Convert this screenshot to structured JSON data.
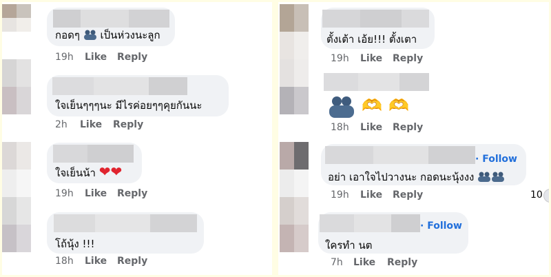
{
  "left": {
    "comments": [
      {
        "text": "กอดๆ",
        "text2": "เป็นห่วงนะลูก",
        "time": "19h",
        "like": "Like",
        "reply": "Reply"
      },
      {
        "text": "ใจเย็นๆๆๆนะ   มีไรค่อยๆๆคุยกันนะ",
        "time": "2h",
        "like": "Like",
        "reply": "Reply"
      },
      {
        "text": "ใจเย็นน้า",
        "time": "19h",
        "like": "Like",
        "reply": "Reply"
      },
      {
        "text": "โถ้นุ้ง !!!",
        "time": "18h",
        "like": "Like",
        "reply": "Reply"
      }
    ]
  },
  "right": {
    "comments": [
      {
        "text": "ตั้งเต้า เอ้ย!!! ตั้งเตา",
        "time": "19h",
        "like": "Like",
        "reply": "Reply"
      },
      {
        "time": "18h",
        "like": "Like",
        "reply": "Reply"
      },
      {
        "follow": "Follow",
        "text": "อย่า เอาใจไปวางนะ กอดนะนุ้งงง",
        "time": "19h",
        "like": "Like",
        "reply": "Reply",
        "reactions": "10"
      },
      {
        "follow": "Follow",
        "text": "ใครทำ นต",
        "time": "7h",
        "like": "Like",
        "reply": "Reply"
      }
    ]
  },
  "icons": {
    "hug": "hugging-people-icon",
    "heart": "red-heart-icon",
    "hands": "heart-hands-icon",
    "reaction": "reaction-icon"
  },
  "colors": {
    "bubble": "#f0f2f5",
    "follow": "#216fdb",
    "meta": "#65676b",
    "heart": "#e0242e"
  }
}
